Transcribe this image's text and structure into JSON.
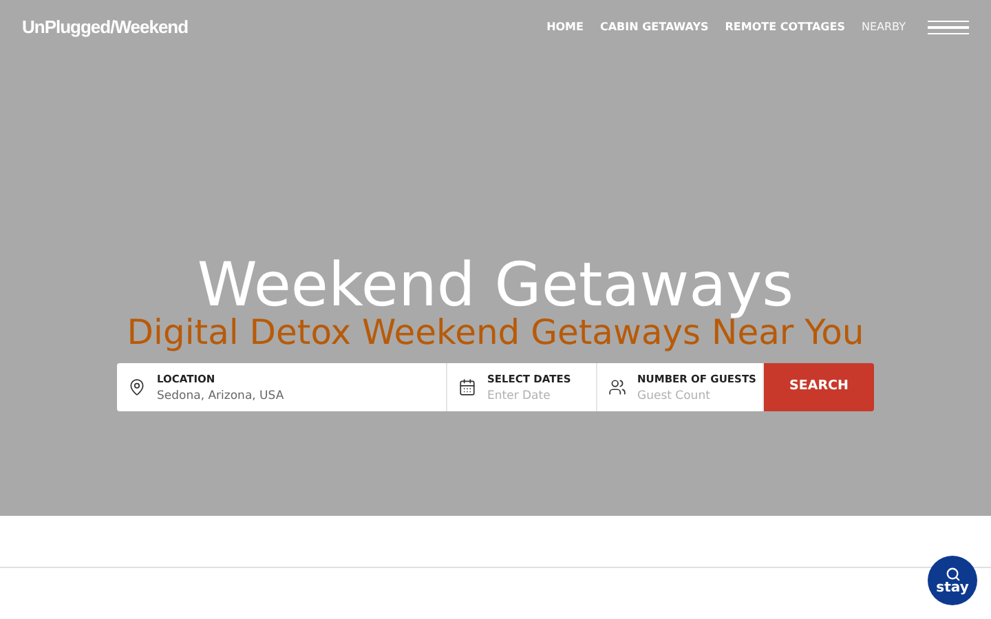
{
  "header": {
    "logo": "UnPlugged/Weekend",
    "nav": [
      {
        "label": "HOME",
        "selected": false
      },
      {
        "label": "CABIN GETAWAYS",
        "selected": false
      },
      {
        "label": "REMOTE COTTAGES",
        "selected": false
      },
      {
        "label": "NEARBY",
        "selected": true
      }
    ]
  },
  "hero": {
    "title": "Weekend Getaways",
    "subtitle": "Digital Detox Weekend Getaways Near You"
  },
  "search": {
    "fields": [
      {
        "kind": "location",
        "label": "LOCATION",
        "value": "Sedona, Arizona, USA"
      },
      {
        "kind": "dates",
        "label": "SELECT DATES",
        "placeholder": "Enter Date"
      },
      {
        "kind": "guests",
        "label": "NUMBER OF GUESTS",
        "placeholder": "Guest Count"
      }
    ],
    "button": "SEARCH"
  },
  "chat_badge": {
    "label": "stay"
  }
}
